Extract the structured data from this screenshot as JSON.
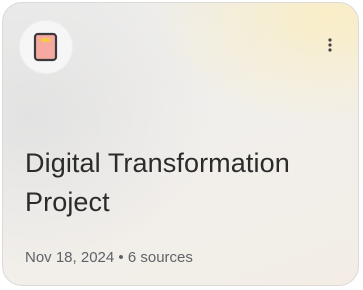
{
  "notebook": {
    "icon": "notebook-emoji-icon",
    "menu_icon": "more-vert-icon",
    "title": "Digital Transformation Project",
    "date": "Nov 18, 2024",
    "separator": "•",
    "sources": "6 sources"
  },
  "colors": {
    "title": "#2b2b2b",
    "meta": "#5f6368",
    "notebook_cover": "#f6a9a0",
    "notebook_label": "#f7c948"
  }
}
